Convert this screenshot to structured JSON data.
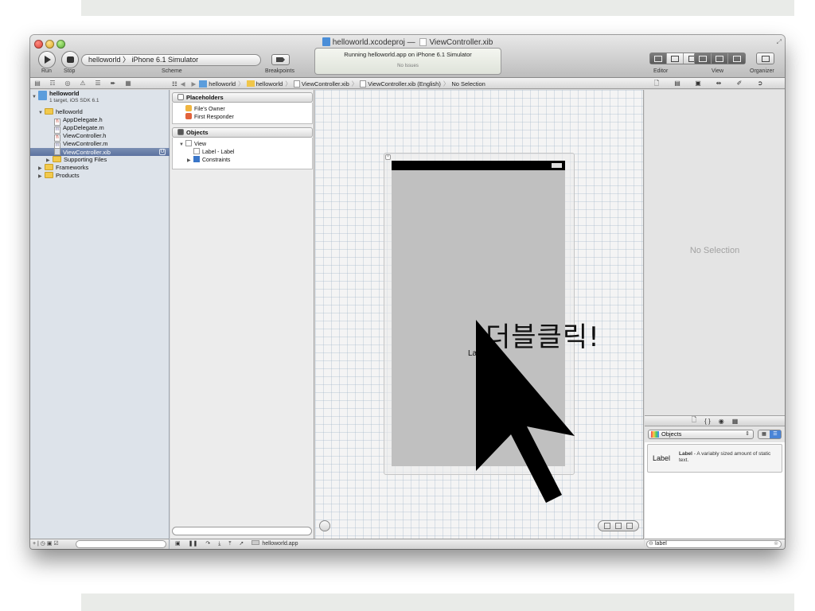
{
  "window": {
    "project_file": "helloworld.xcodeproj",
    "title_sep": "—",
    "document": "ViewController.xib",
    "fullscreen_icon": "fullscreen-arrows-icon"
  },
  "toolbar": {
    "run_label": "Run",
    "stop_label": "Stop",
    "scheme_label": "Scheme",
    "scheme_value": "helloworld 〉 iPhone 6.1 Simulator",
    "breakpoints_label": "Breakpoints",
    "activity_status": "Running helloworld.app on iPhone 6.1 Simulator",
    "activity_issues": "No Issues",
    "editor_label": "Editor",
    "view_label": "View",
    "organizer_label": "Organizer"
  },
  "jumpbar": {
    "back": "◀",
    "forward": "▶",
    "crumbs": [
      "helloworld",
      "helloworld",
      "ViewController.xib",
      "ViewController.xib (English)",
      "No Selection"
    ]
  },
  "navigator": {
    "project_name": "helloworld",
    "project_sub": "1 target, iOS SDK 6.1",
    "group": "helloworld",
    "files": [
      "AppDelegate.h",
      "AppDelegate.m",
      "ViewController.h",
      "ViewController.m",
      "ViewController.xib"
    ],
    "supporting": "Supporting Files",
    "frameworks": "Frameworks",
    "products": "Products",
    "footer_icons": "+ | ◷ ▣ ☑"
  },
  "outline": {
    "placeholders_title": "Placeholders",
    "files_owner": "File's Owner",
    "first_responder": "First Responder",
    "objects_title": "Objects",
    "view": "View",
    "label_item": "Label - Label",
    "constraints": "Constraints"
  },
  "canvas": {
    "label_text": "Label",
    "overlay_text": "더블클릭!"
  },
  "debug": {
    "app_name": "helloworld.app"
  },
  "inspector": {
    "no_selection": "No Selection"
  },
  "library": {
    "popup_value": "Objects",
    "item_name": "Label",
    "item_title": "Label",
    "item_desc": " - A variably sized amount of static text.",
    "filter_value": "label"
  },
  "colors": {
    "selection": "#5b72a0",
    "navigator_bg": "#dde3ea",
    "device_view": "#c0c0c0"
  }
}
